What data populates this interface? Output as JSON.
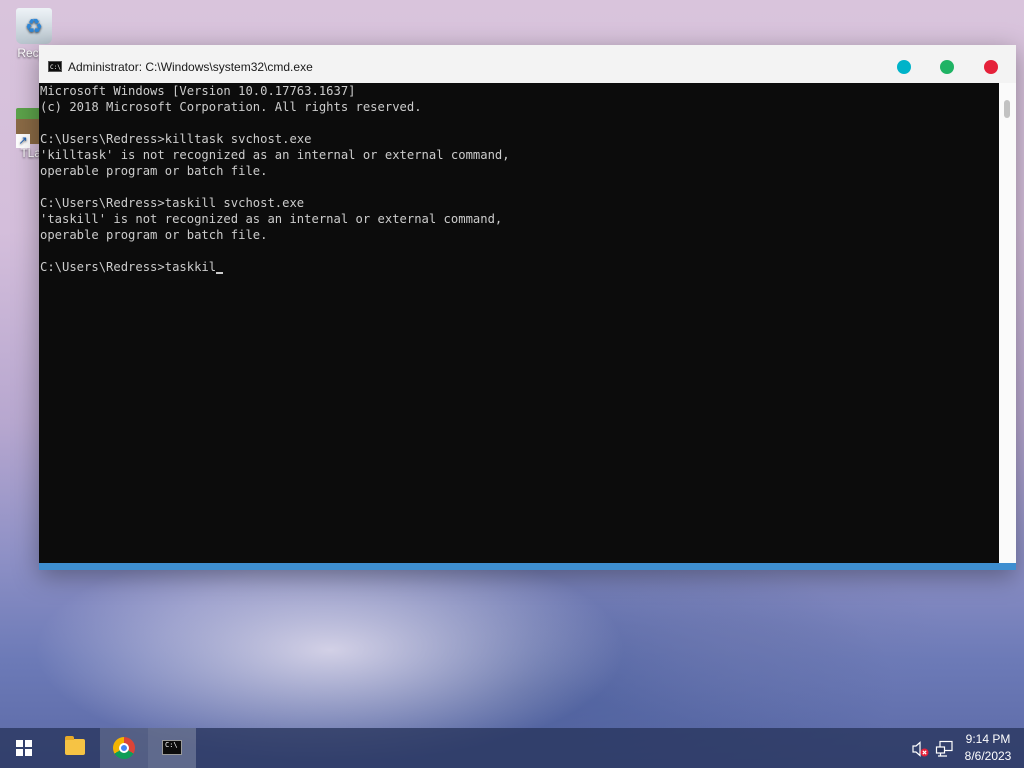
{
  "desktop": {
    "icons": [
      {
        "label": "Recyc"
      },
      {
        "label": "TLau"
      }
    ]
  },
  "window": {
    "title": "Administrator: C:\\Windows\\system32\\cmd.exe",
    "app_icon_text": "C:\\",
    "controls": {
      "minimize_color": "#00b3c9",
      "maximize_color": "#1fb364",
      "close_color": "#e5213a"
    }
  },
  "console": {
    "lines": [
      "Microsoft Windows [Version 10.0.17763.1637]",
      "(c) 2018 Microsoft Corporation. All rights reserved.",
      "",
      "C:\\Users\\Redress>killtask svchost.exe",
      "'killtask' is not recognized as an internal or external command,",
      "operable program or batch file.",
      "",
      "C:\\Users\\Redress>taskill svchost.exe",
      "'taskill' is not recognized as an internal or external command,",
      "operable program or batch file.",
      "",
      "C:\\Users\\Redress>taskkil"
    ]
  },
  "taskbar": {
    "items": [
      {
        "name": "start-button",
        "icon": "windows-logo-icon"
      },
      {
        "name": "file-explorer-button",
        "icon": "folder-icon"
      },
      {
        "name": "chrome-button",
        "icon": "chrome-icon"
      },
      {
        "name": "cmd-button",
        "icon": "terminal-icon"
      }
    ],
    "tray": {
      "volume_icon": "volume-muted-icon",
      "network_icon": "network-icon"
    },
    "clock": {
      "time": "9:14 PM",
      "date": "8/6/2023"
    }
  },
  "colors": {
    "accent": "#3e8ed0",
    "console_bg": "#0c0c0c",
    "console_fg": "#cccccc"
  }
}
